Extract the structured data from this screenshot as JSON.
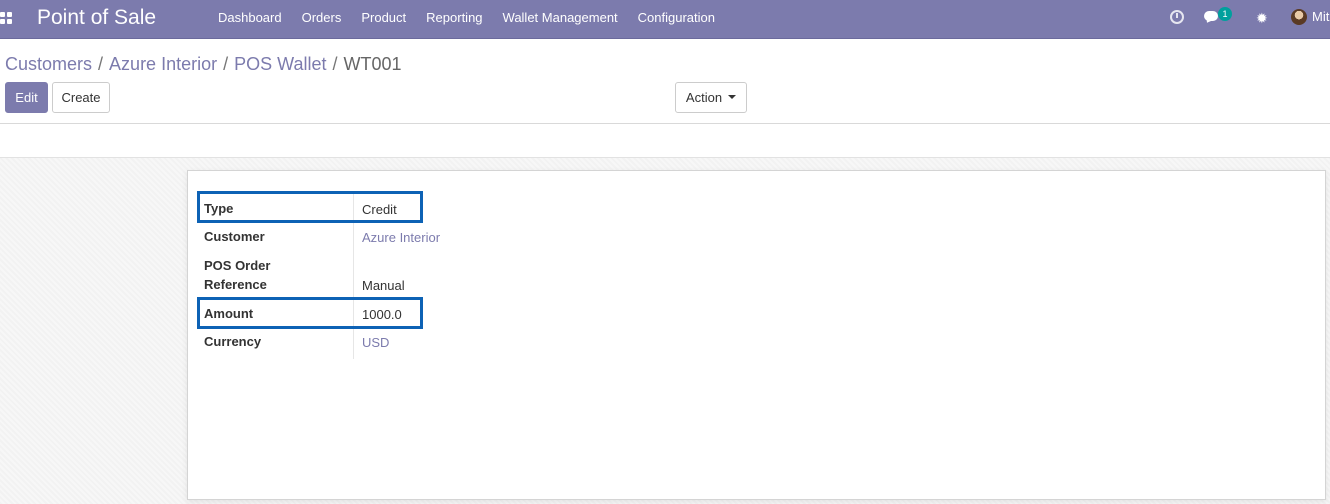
{
  "navbar": {
    "brand": "Point of Sale",
    "menu": [
      "Dashboard",
      "Orders",
      "Product",
      "Reporting",
      "Wallet Management",
      "Configuration"
    ],
    "chat_count": "1",
    "user_name": "Mit"
  },
  "breadcrumb": {
    "items": [
      "Customers",
      "Azure Interior",
      "POS Wallet"
    ],
    "separator": "/",
    "current": "WT001"
  },
  "buttons": {
    "edit": "Edit",
    "create": "Create",
    "action": "Action"
  },
  "form": {
    "fields": [
      {
        "label": "Type",
        "value": "Credit",
        "highlighted": true
      },
      {
        "label": "Customer",
        "value": "Azure Interior",
        "link": true
      },
      {
        "label": "POS Order Reference",
        "label_line1": "POS Order",
        "label_line2": "Reference",
        "value": "Manual"
      },
      {
        "label": "Amount",
        "value": "1000.0",
        "highlighted": true
      },
      {
        "label": "Currency",
        "value": "USD",
        "link": true
      }
    ]
  },
  "colors": {
    "brand": "#7c7bad",
    "highlight_box": "#0d62b5",
    "badge": "#00a09d"
  },
  "icons": [
    "apps-grid-icon",
    "clock-icon",
    "chat-icon",
    "bug-icon",
    "user-avatar-icon",
    "caret-down-icon"
  ]
}
